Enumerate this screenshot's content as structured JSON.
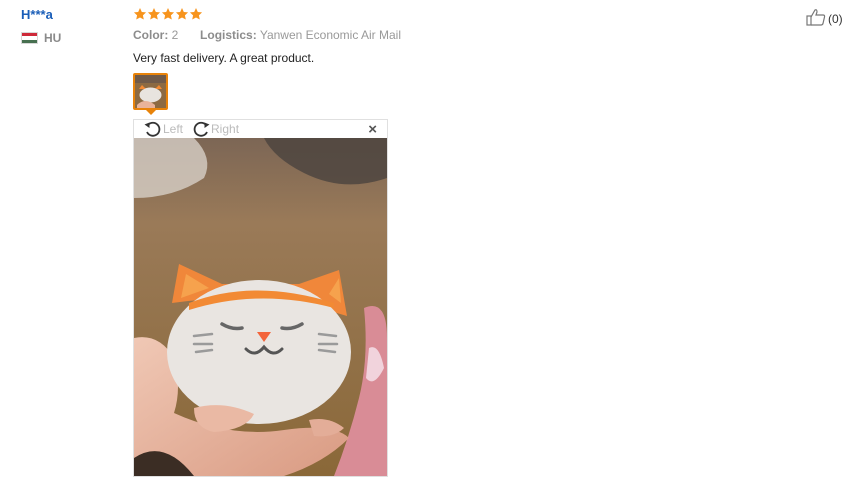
{
  "review": {
    "user_name": "H***a",
    "country_code": "HU",
    "rating": 5,
    "color_label": "Color:",
    "color_value": "2",
    "logistics_label": "Logistics:",
    "logistics_value": "Yanwen Economic Air Mail",
    "text": "Very fast delivery. A great product.",
    "likes": "(0)"
  },
  "viewer": {
    "rotate_left_label": "Left",
    "rotate_right_label": "Right",
    "close_label": "×"
  },
  "colors": {
    "username": "#1a5eb8",
    "star": "#f7941d",
    "thumb_border": "#e8830a",
    "flag": [
      "#ce2939",
      "#ffffff",
      "#477050"
    ]
  },
  "icons": {
    "rotate_left": "rotate-left-icon",
    "rotate_right": "rotate-right-icon",
    "close": "close-icon",
    "like": "thumbs-up-icon",
    "star": "star-icon"
  }
}
